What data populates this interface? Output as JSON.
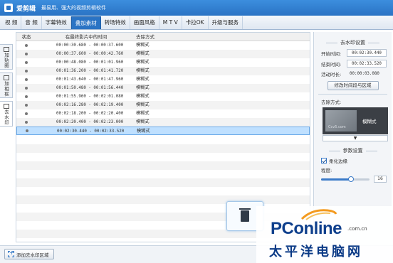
{
  "app": {
    "name": "爱剪辑",
    "slogan": "最易用、强大的视频剪辑软件"
  },
  "menu": {
    "tabs": [
      {
        "label": "视 频"
      },
      {
        "label": "音 频"
      },
      {
        "label": "字幕特效"
      },
      {
        "label": "叠加素材"
      },
      {
        "label": "转场特效"
      },
      {
        "label": "画面风格"
      },
      {
        "label": "M T V"
      },
      {
        "label": "卡拉OK"
      },
      {
        "label": "升级与服务"
      }
    ],
    "active_index": 3
  },
  "side_tabs": [
    {
      "label": "加贴图"
    },
    {
      "label": "加相框"
    },
    {
      "label": "去水印"
    }
  ],
  "table": {
    "headers": {
      "status": "状态",
      "time": "在最终影片中的时间",
      "mode": "去除方式"
    },
    "rows": [
      {
        "time": "00:00:30.680 - 00:00:37.600",
        "mode": "模糊式"
      },
      {
        "time": "00:00:37.600 - 00:00:42.760",
        "mode": "模糊式"
      },
      {
        "time": "00:00:48.080 - 00:01:01.960",
        "mode": "模糊式"
      },
      {
        "time": "00:01:36.200 - 00:01:41.720",
        "mode": "模糊式"
      },
      {
        "time": "00:01:43.640 - 00:01:47.960",
        "mode": "模糊式"
      },
      {
        "time": "00:01:50.480 - 00:01:56.440",
        "mode": "模糊式"
      },
      {
        "time": "00:01:55.960 - 00:02:01.080",
        "mode": "模糊式"
      },
      {
        "time": "00:02:16.280 - 00:02:19.400",
        "mode": "模糊式"
      },
      {
        "time": "00:02:18.200 - 00:02:20.400",
        "mode": "模糊式"
      },
      {
        "time": "00:02:20.400 - 00:02:23.000",
        "mode": "模糊式"
      },
      {
        "time": "00:02:30.440 - 00:02:33.520",
        "mode": "模糊式"
      }
    ],
    "selected_index": 10
  },
  "panel": {
    "title": "去水印设置",
    "start_label": "开始时间:",
    "start_value": "00:02:30.440",
    "end_label": "结束时间:",
    "end_value": "00:02:33.520",
    "duration_label": "活动时长:",
    "duration_value": "00:00:03.080",
    "modify_button": "修改时间段与区域",
    "mode_label": "去除方式:",
    "mode_thumb_text": "Ccv5.com",
    "mode_value": "模糊式",
    "dropdown_arrow": "▼",
    "params_title": "参数设置",
    "soften_label": "柔化边缘",
    "soften_checked": true,
    "degree_label": "程度:",
    "degree_value": "16",
    "degree_fraction": 0.62
  },
  "bottom": {
    "add_button": "添加去水印区域"
  },
  "watermark": {
    "brand": "PConline",
    "domain": ".com.cn",
    "cn": "太平洋电脑网"
  },
  "colors": {
    "accent": "#2a73c4",
    "selected_row": "#bfe0ff"
  }
}
